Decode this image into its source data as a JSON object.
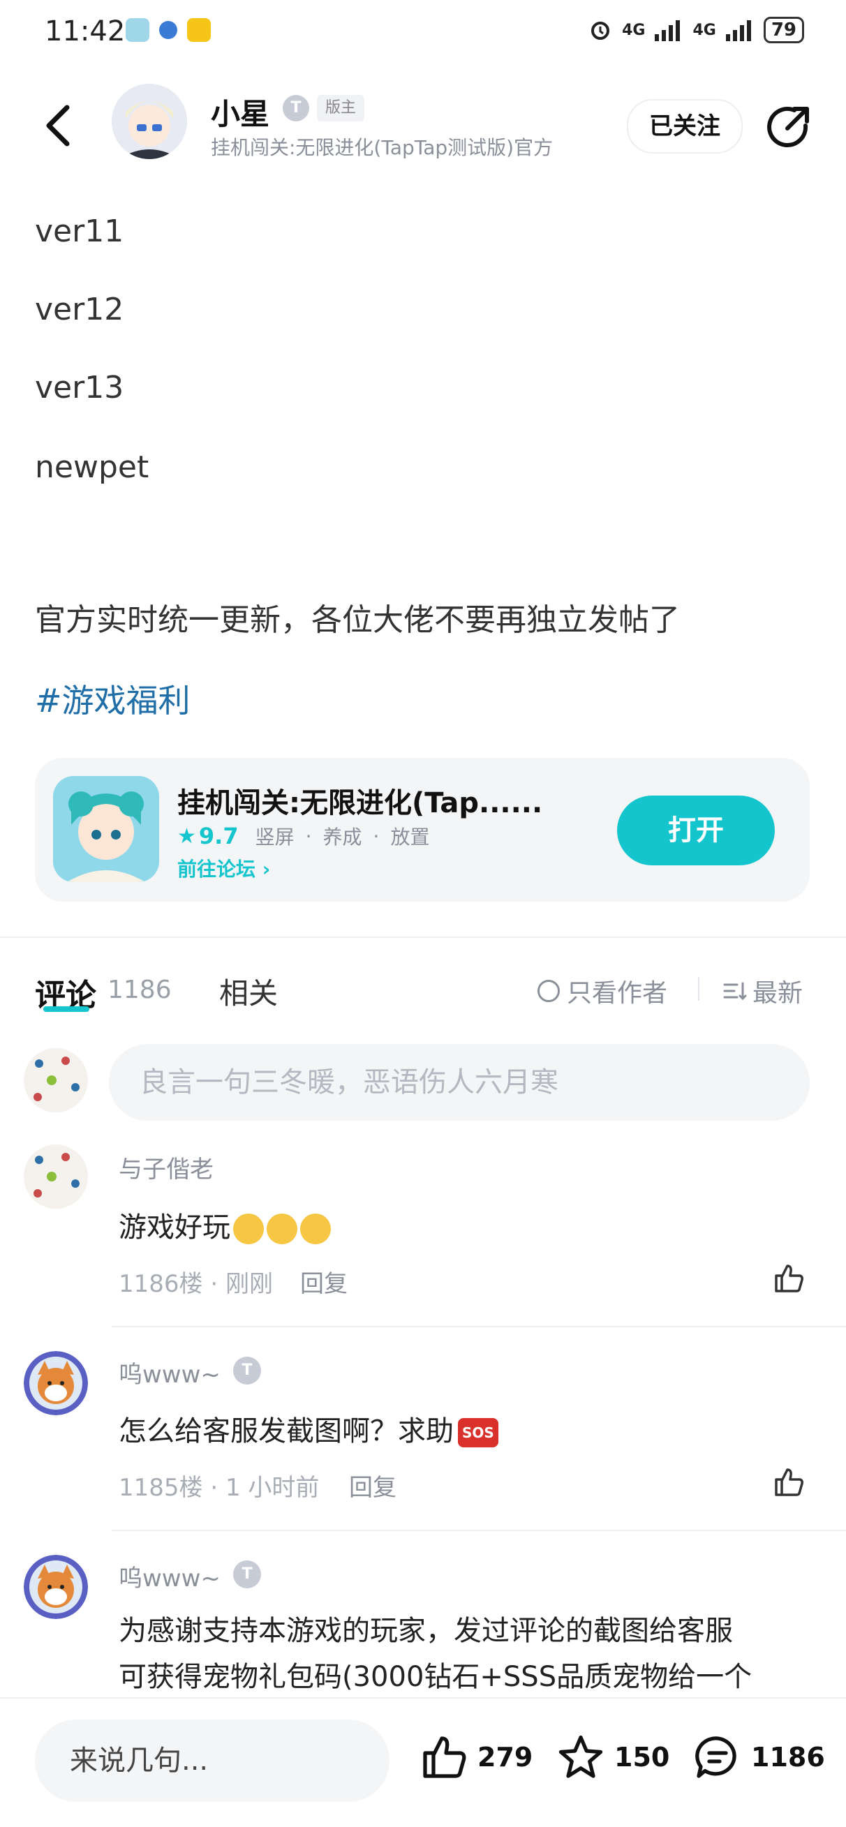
{
  "status_bar": {
    "time": "11:42",
    "battery": "79",
    "network_1": "4G",
    "network_2": "4G"
  },
  "header": {
    "author_name": "小星",
    "level_badge": "T",
    "role_badge": "版主",
    "author_subtitle": "挂机闯关:无限进化(TapTap测试版)官方",
    "follow_label": "已关注"
  },
  "post": {
    "lines": [
      "ver11",
      "ver12",
      "ver13",
      "newpet"
    ],
    "text": "官方实时统一更新，各位大佬不要再独立发帖了",
    "hashtag": "#游戏福利"
  },
  "game_card": {
    "title": "挂机闯关:无限进化(Tap......",
    "score": "9.7",
    "tags": [
      "竖屏",
      "养成",
      "放置"
    ],
    "forum_link": "前往论坛",
    "open_label": "打开"
  },
  "tabs": {
    "comments_label": "评论",
    "comments_count": "1186",
    "related_label": "相关",
    "author_only_label": "只看作者",
    "sort_label": "最新"
  },
  "comment_input": {
    "placeholder": "良言一句三冬暖，恶语伤人六月寒"
  },
  "comments": [
    {
      "name": "与子偕老",
      "text": "游戏好玩",
      "floor": "1186楼",
      "time": "刚刚",
      "reply": "回复"
    },
    {
      "name": "呜www~",
      "badge": "T",
      "text": "怎么给客服发截图啊？求助",
      "emoji": "SOS",
      "floor": "1185楼",
      "time": "1 小时前",
      "reply": "回复"
    },
    {
      "name": "呜www~",
      "badge": "T",
      "text_line1": "为感谢支持本游戏的玩家，发过评论的截图给客服",
      "text_line2": "可获得宠物礼包码(3000钻石+SSS品质宠物给一个"
    }
  ],
  "bottom_bar": {
    "placeholder": "来说几句...",
    "likes": "279",
    "favorites": "150",
    "comments": "1186"
  },
  "colors": {
    "accent": "#15c5ce",
    "hashtag": "#1f6ea8",
    "muted": "#8a8f99"
  }
}
